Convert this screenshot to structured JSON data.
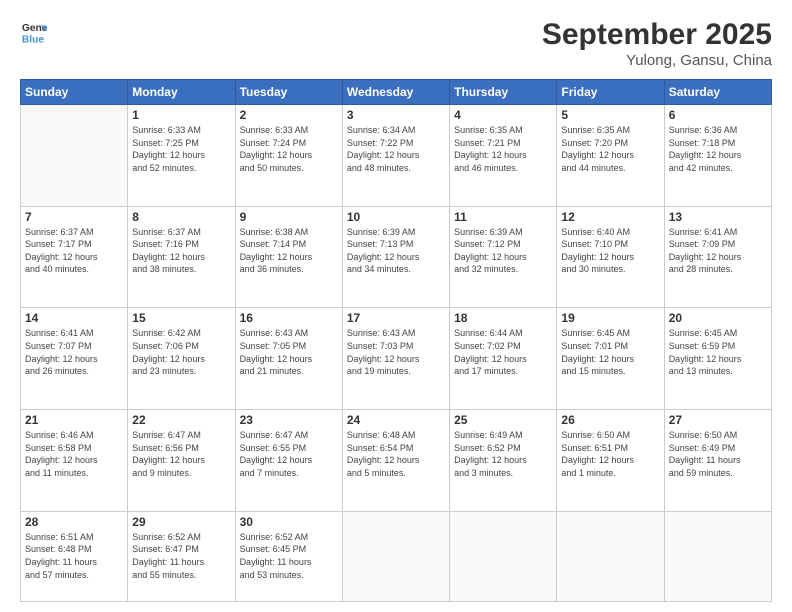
{
  "header": {
    "logo_line1": "General",
    "logo_line2": "Blue",
    "title": "September 2025",
    "subtitle": "Yulong, Gansu, China"
  },
  "weekdays": [
    "Sunday",
    "Monday",
    "Tuesday",
    "Wednesday",
    "Thursday",
    "Friday",
    "Saturday"
  ],
  "weeks": [
    [
      {
        "day": "",
        "info": ""
      },
      {
        "day": "1",
        "info": "Sunrise: 6:33 AM\nSunset: 7:25 PM\nDaylight: 12 hours\nand 52 minutes."
      },
      {
        "day": "2",
        "info": "Sunrise: 6:33 AM\nSunset: 7:24 PM\nDaylight: 12 hours\nand 50 minutes."
      },
      {
        "day": "3",
        "info": "Sunrise: 6:34 AM\nSunset: 7:22 PM\nDaylight: 12 hours\nand 48 minutes."
      },
      {
        "day": "4",
        "info": "Sunrise: 6:35 AM\nSunset: 7:21 PM\nDaylight: 12 hours\nand 46 minutes."
      },
      {
        "day": "5",
        "info": "Sunrise: 6:35 AM\nSunset: 7:20 PM\nDaylight: 12 hours\nand 44 minutes."
      },
      {
        "day": "6",
        "info": "Sunrise: 6:36 AM\nSunset: 7:18 PM\nDaylight: 12 hours\nand 42 minutes."
      }
    ],
    [
      {
        "day": "7",
        "info": "Sunrise: 6:37 AM\nSunset: 7:17 PM\nDaylight: 12 hours\nand 40 minutes."
      },
      {
        "day": "8",
        "info": "Sunrise: 6:37 AM\nSunset: 7:16 PM\nDaylight: 12 hours\nand 38 minutes."
      },
      {
        "day": "9",
        "info": "Sunrise: 6:38 AM\nSunset: 7:14 PM\nDaylight: 12 hours\nand 36 minutes."
      },
      {
        "day": "10",
        "info": "Sunrise: 6:39 AM\nSunset: 7:13 PM\nDaylight: 12 hours\nand 34 minutes."
      },
      {
        "day": "11",
        "info": "Sunrise: 6:39 AM\nSunset: 7:12 PM\nDaylight: 12 hours\nand 32 minutes."
      },
      {
        "day": "12",
        "info": "Sunrise: 6:40 AM\nSunset: 7:10 PM\nDaylight: 12 hours\nand 30 minutes."
      },
      {
        "day": "13",
        "info": "Sunrise: 6:41 AM\nSunset: 7:09 PM\nDaylight: 12 hours\nand 28 minutes."
      }
    ],
    [
      {
        "day": "14",
        "info": "Sunrise: 6:41 AM\nSunset: 7:07 PM\nDaylight: 12 hours\nand 26 minutes."
      },
      {
        "day": "15",
        "info": "Sunrise: 6:42 AM\nSunset: 7:06 PM\nDaylight: 12 hours\nand 23 minutes."
      },
      {
        "day": "16",
        "info": "Sunrise: 6:43 AM\nSunset: 7:05 PM\nDaylight: 12 hours\nand 21 minutes."
      },
      {
        "day": "17",
        "info": "Sunrise: 6:43 AM\nSunset: 7:03 PM\nDaylight: 12 hours\nand 19 minutes."
      },
      {
        "day": "18",
        "info": "Sunrise: 6:44 AM\nSunset: 7:02 PM\nDaylight: 12 hours\nand 17 minutes."
      },
      {
        "day": "19",
        "info": "Sunrise: 6:45 AM\nSunset: 7:01 PM\nDaylight: 12 hours\nand 15 minutes."
      },
      {
        "day": "20",
        "info": "Sunrise: 6:45 AM\nSunset: 6:59 PM\nDaylight: 12 hours\nand 13 minutes."
      }
    ],
    [
      {
        "day": "21",
        "info": "Sunrise: 6:46 AM\nSunset: 6:58 PM\nDaylight: 12 hours\nand 11 minutes."
      },
      {
        "day": "22",
        "info": "Sunrise: 6:47 AM\nSunset: 6:56 PM\nDaylight: 12 hours\nand 9 minutes."
      },
      {
        "day": "23",
        "info": "Sunrise: 6:47 AM\nSunset: 6:55 PM\nDaylight: 12 hours\nand 7 minutes."
      },
      {
        "day": "24",
        "info": "Sunrise: 6:48 AM\nSunset: 6:54 PM\nDaylight: 12 hours\nand 5 minutes."
      },
      {
        "day": "25",
        "info": "Sunrise: 6:49 AM\nSunset: 6:52 PM\nDaylight: 12 hours\nand 3 minutes."
      },
      {
        "day": "26",
        "info": "Sunrise: 6:50 AM\nSunset: 6:51 PM\nDaylight: 12 hours\nand 1 minute."
      },
      {
        "day": "27",
        "info": "Sunrise: 6:50 AM\nSunset: 6:49 PM\nDaylight: 11 hours\nand 59 minutes."
      }
    ],
    [
      {
        "day": "28",
        "info": "Sunrise: 6:51 AM\nSunset: 6:48 PM\nDaylight: 11 hours\nand 57 minutes."
      },
      {
        "day": "29",
        "info": "Sunrise: 6:52 AM\nSunset: 6:47 PM\nDaylight: 11 hours\nand 55 minutes."
      },
      {
        "day": "30",
        "info": "Sunrise: 6:52 AM\nSunset: 6:45 PM\nDaylight: 11 hours\nand 53 minutes."
      },
      {
        "day": "",
        "info": ""
      },
      {
        "day": "",
        "info": ""
      },
      {
        "day": "",
        "info": ""
      },
      {
        "day": "",
        "info": ""
      }
    ]
  ]
}
